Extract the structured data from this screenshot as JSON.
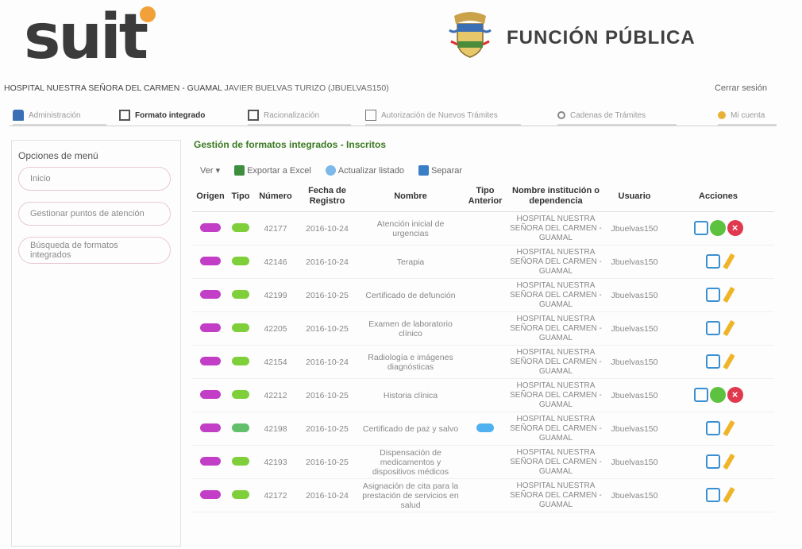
{
  "header": {
    "logo": "suit",
    "org": "FUNCIÓN PÚBLICA"
  },
  "userbar": {
    "hospital": "HOSPITAL  NUESTRA SEÑORA DEL CARMEN - GUAMAL",
    "user": "JAVIER BUELVAS TURIZO (JBUELVAS150)",
    "logout": "Cerrar sesión"
  },
  "tabs": [
    {
      "label": "Administración",
      "icon": "admin-icon"
    },
    {
      "label": "Formato integrado",
      "icon": "document-icon"
    },
    {
      "label": "Racionalización",
      "icon": "edit-icon"
    },
    {
      "label": "Autorización de Nuevos Trámites",
      "icon": "checkbox-icon"
    },
    {
      "label": "Cadenas de Trámites",
      "icon": "chain-icon"
    },
    {
      "label": "Mi cuenta",
      "icon": "user-icon"
    }
  ],
  "sidebar": {
    "title": "Opciones de menú",
    "items": [
      "Inicio",
      "Gestionar puntos de atención",
      "Búsqueda de formatos integrados"
    ]
  },
  "main": {
    "title": "Gestión de formatos integrados - Inscritos",
    "toolbar": {
      "ver": "Ver ▾",
      "export": "Exportar a Excel",
      "refresh": "Actualizar listado",
      "separate": "Separar"
    },
    "columns": [
      "Origen",
      "Tipo",
      "Número",
      "Fecha de Registro",
      "Nombre",
      "Tipo Anterior",
      "Nombre institución o dependencia",
      "Usuario",
      "Acciones"
    ],
    "rows": [
      {
        "numero": "42177",
        "fecha": "2016-10-24",
        "nombre": "Atención inicial de urgencias",
        "tipo_ant": "",
        "inst": "HOSPITAL  NUESTRA SEÑORA DEL CARMEN - GUAMAL",
        "usuario": "Jbuelvas150",
        "tipo_color": "#7fcf3a",
        "acciones": "approve"
      },
      {
        "numero": "42146",
        "fecha": "2016-10-24",
        "nombre": "Terapia",
        "tipo_ant": "",
        "inst": "HOSPITAL  NUESTRA SEÑORA DEL CARMEN - GUAMAL",
        "usuario": "Jbuelvas150",
        "tipo_color": "#7fcf3a",
        "acciones": "edit"
      },
      {
        "numero": "42199",
        "fecha": "2016-10-25",
        "nombre": "Certificado de defunción",
        "tipo_ant": "",
        "inst": "HOSPITAL  NUESTRA SEÑORA DEL CARMEN - GUAMAL",
        "usuario": "Jbuelvas150",
        "tipo_color": "#7fcf3a",
        "acciones": "edit"
      },
      {
        "numero": "42205",
        "fecha": "2016-10-25",
        "nombre": "Examen de laboratorio clínico",
        "tipo_ant": "",
        "inst": "HOSPITAL  NUESTRA SEÑORA DEL CARMEN - GUAMAL",
        "usuario": "Jbuelvas150",
        "tipo_color": "#7fcf3a",
        "acciones": "edit"
      },
      {
        "numero": "42154",
        "fecha": "2016-10-24",
        "nombre": "Radiología e imágenes diagnósticas",
        "tipo_ant": "",
        "inst": "HOSPITAL  NUESTRA SEÑORA DEL CARMEN - GUAMAL",
        "usuario": "Jbuelvas150",
        "tipo_color": "#7fcf3a",
        "acciones": "edit"
      },
      {
        "numero": "42212",
        "fecha": "2016-10-25",
        "nombre": "Historia clínica",
        "tipo_ant": "",
        "inst": "HOSPITAL  NUESTRA SEÑORA DEL CARMEN - GUAMAL",
        "usuario": "Jbuelvas150",
        "tipo_color": "#7fcf3a",
        "acciones": "approve"
      },
      {
        "numero": "42198",
        "fecha": "2016-10-25",
        "nombre": "Certificado de paz y salvo",
        "tipo_ant": "pill",
        "inst": "HOSPITAL  NUESTRA SEÑORA DEL CARMEN - GUAMAL",
        "usuario": "Jbuelvas150",
        "tipo_color": "#62c06b",
        "acciones": "edit"
      },
      {
        "numero": "42193",
        "fecha": "2016-10-25",
        "nombre": "Dispensación de medicamentos y dispositivos médicos",
        "tipo_ant": "",
        "inst": "HOSPITAL  NUESTRA SEÑORA DEL CARMEN - GUAMAL",
        "usuario": "Jbuelvas150",
        "tipo_color": "#7fcf3a",
        "acciones": "edit"
      },
      {
        "numero": "42172",
        "fecha": "2016-10-24",
        "nombre": "Asignación de cita para la prestación de servicios en salud",
        "tipo_ant": "",
        "inst": "HOSPITAL  NUESTRA SEÑORA DEL CARMEN - GUAMAL",
        "usuario": "Jbuelvas150",
        "tipo_color": "#7fcf3a",
        "acciones": "edit"
      }
    ]
  },
  "colors": {
    "origen": "#c23ec6",
    "title_green": "#3a7a20",
    "accent_orange": "#f2a13a"
  }
}
